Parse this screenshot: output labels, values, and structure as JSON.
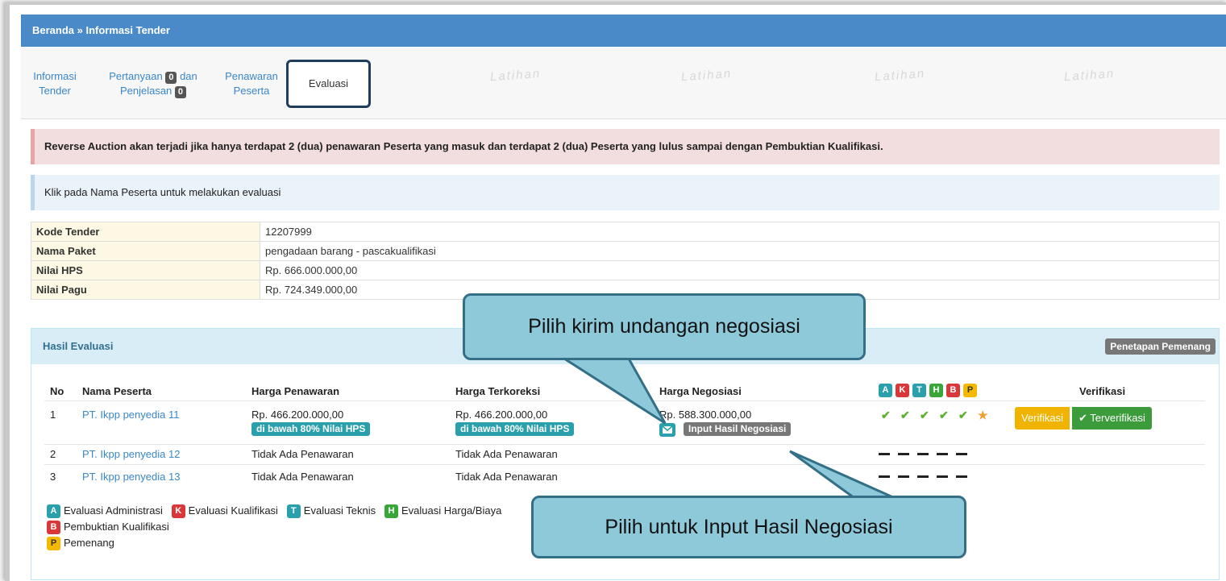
{
  "breadcrumb": "Beranda » Informasi Tender",
  "tabs": {
    "informasi": [
      "Informasi",
      "Tender"
    ],
    "pertanyaan_a": "Pertanyaan",
    "pertanyaan_badge1": "0",
    "pertanyaan_dan": "dan",
    "penjelasan": "Penjelasan",
    "pertanyaan_badge2": "0",
    "penawaran": [
      "Penawaran",
      "Peserta"
    ],
    "evaluasi": "Evaluasi"
  },
  "watermark": "Latihan",
  "alert_red": "Reverse Auction akan terjadi jika hanya terdapat 2 (dua) penawaran Peserta yang masuk dan terdapat 2 (dua) Peserta yang lulus sampai dengan Pembuktian Kualifikasi.",
  "alert_blue": "Klik pada Nama Peserta untuk melakukan evaluasi",
  "info": [
    {
      "key": "Kode Tender",
      "value": "12207999"
    },
    {
      "key": "Nama Paket",
      "value": "pengadaan barang - pascakualifikasi"
    },
    {
      "key": "Nilai HPS",
      "value": "Rp. 666.000.000,00"
    },
    {
      "key": "Nilai Pagu",
      "value": "Rp. 724.349.000,00"
    }
  ],
  "panel": {
    "title": "Hasil Evaluasi",
    "btn_penetapan": "Penetapan Pemenang",
    "headers": {
      "no": "No",
      "nama": "Nama Peserta",
      "penawaran": "Harga Penawaran",
      "terkoreksi": "Harga Terkoreksi",
      "negosiasi": "Harga Negosiasi",
      "verifikasi": "Verifikasi"
    },
    "stage_letters": [
      "A",
      "K",
      "T",
      "H",
      "B",
      "P"
    ],
    "rows": [
      {
        "no": "1",
        "nama": "PT. Ikpp penyedia 11",
        "penawaran": "Rp. 466.200.000,00",
        "penawaran_label": "di bawah 80% Nilai HPS",
        "terkoreksi": "Rp. 466.200.000,00",
        "terkoreksi_label": "di bawah 80% Nilai HPS",
        "negosiasi": "Rp. 588.300.000,00",
        "input_nego": "Input Hasil Negosiasi",
        "btn_verifikasi": "Verifikasi",
        "btn_terverifikasi": "Terverifikasi"
      },
      {
        "no": "2",
        "nama": "PT. Ikpp penyedia 12",
        "penawaran": "Tidak Ada Penawaran",
        "terkoreksi": "Tidak Ada Penawaran"
      },
      {
        "no": "3",
        "nama": "PT. Ikpp penyedia 13",
        "penawaran": "Tidak Ada Penawaran",
        "terkoreksi": "Tidak Ada Penawaran"
      }
    ],
    "legend": [
      {
        "letter": "A",
        "label": "Evaluasi Administrasi"
      },
      {
        "letter": "K",
        "label": "Evaluasi Kualifikasi"
      },
      {
        "letter": "T",
        "label": "Evaluasi Teknis"
      },
      {
        "letter": "H",
        "label": "Evaluasi Harga/Biaya"
      },
      {
        "letter": "B",
        "label": "Pembuktian Kualifikasi"
      },
      {
        "letter": "P",
        "label": "Pemenang"
      }
    ]
  },
  "callouts": {
    "top": "Pilih kirim undangan negosiasi",
    "bottom": "Pilih untuk Input Hasil Negosiasi"
  },
  "colors": {
    "topbar": "#4a8ac9",
    "callout_fill": "#8ec9da",
    "callout_border": "#336f86"
  }
}
